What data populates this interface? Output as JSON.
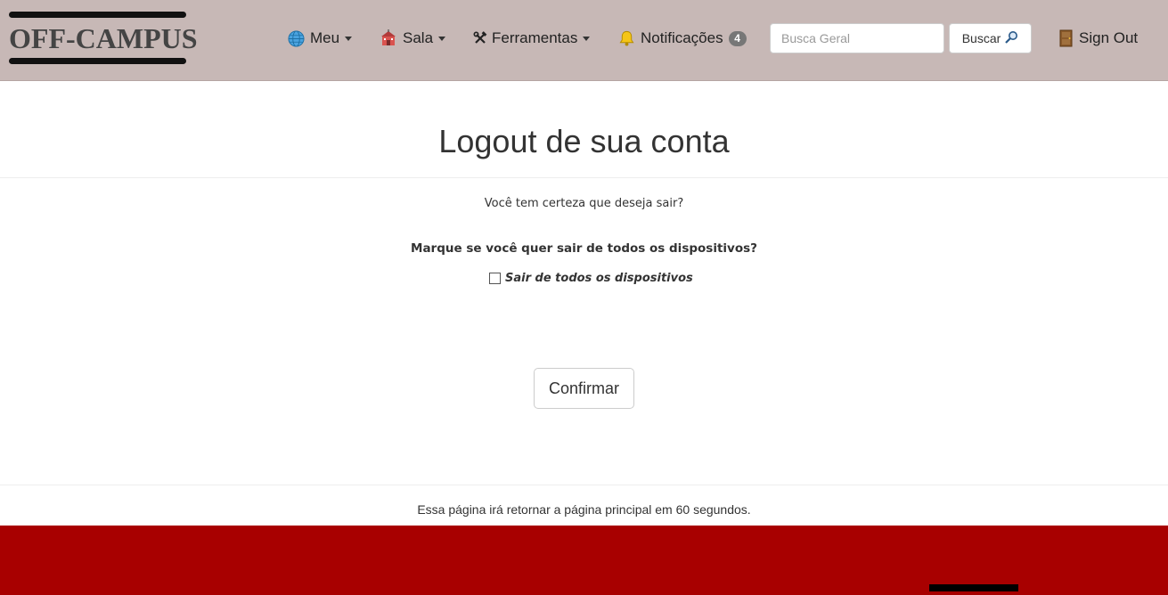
{
  "logo": {
    "text": "OFF-CAMPUS"
  },
  "nav": {
    "items": [
      {
        "label": "Meu",
        "icon": "globe-icon"
      },
      {
        "label": "Sala",
        "icon": "school-icon"
      },
      {
        "label": "Ferramentas",
        "icon": "tools-icon"
      },
      {
        "label": "Notificações",
        "icon": "bell-icon",
        "badge": "4"
      }
    ],
    "search": {
      "placeholder": "Busca Geral",
      "value": "",
      "button_label": "Buscar"
    },
    "signout": {
      "label": "Sign Out",
      "icon": "door-icon"
    }
  },
  "main": {
    "title": "Logout de sua conta",
    "question": "Você tem certeza que deseja sair?",
    "all_devices_question": "Marque se você quer sair de todos os dispositivos?",
    "checkbox_label": "Sair de todos os dispositivos",
    "checkbox_checked": false,
    "confirm_label": "Confirmar",
    "redirect_note": "Essa página irá retornar a página principal em 60 segundos."
  },
  "colors": {
    "navbar": "#c7b8b6",
    "footer": "#a80000",
    "badge": "#777777"
  }
}
